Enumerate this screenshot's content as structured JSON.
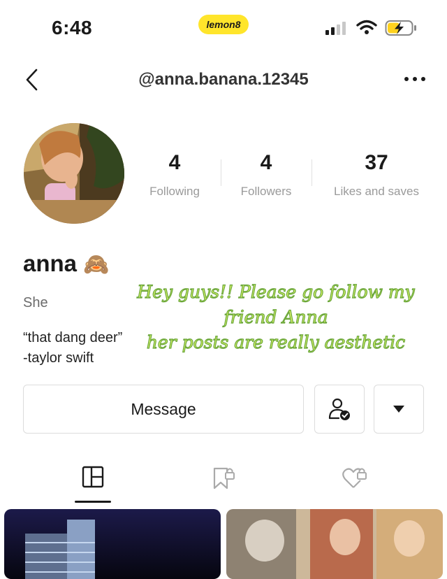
{
  "status_bar": {
    "time": "6:48",
    "app_badge": "lemon8",
    "icons": [
      "cellular-signal-icon",
      "wifi-icon",
      "battery-charging-icon"
    ],
    "badge_color": "#ffe52b"
  },
  "header": {
    "back_icon": "chevron-left-icon",
    "handle": "@anna.banana.12345",
    "more_icon": "more-dots-icon"
  },
  "profile": {
    "stats": [
      {
        "value": "4",
        "label": "Following"
      },
      {
        "value": "4",
        "label": "Followers"
      },
      {
        "value": "37",
        "label": "Likes and saves"
      }
    ],
    "name": "anna",
    "name_emoji": "🙈",
    "bio_line1": "She",
    "bio_quote": "“that dang deer”",
    "bio_attribution": "-taylor swift"
  },
  "overlay_text": {
    "line1": "Hey guys!! Please go follow my friend Anna",
    "line2": "her posts are really aesthetic",
    "color": "#d8f36a"
  },
  "actions": {
    "message_label": "Message",
    "icons": [
      "follow-status-icon",
      "dropdown-caret-icon"
    ]
  },
  "tabs": [
    {
      "icon": "grid-icon",
      "active": true
    },
    {
      "icon": "saved-bookmark-lock-icon",
      "active": false
    },
    {
      "icon": "liked-heart-lock-icon",
      "active": false
    }
  ]
}
